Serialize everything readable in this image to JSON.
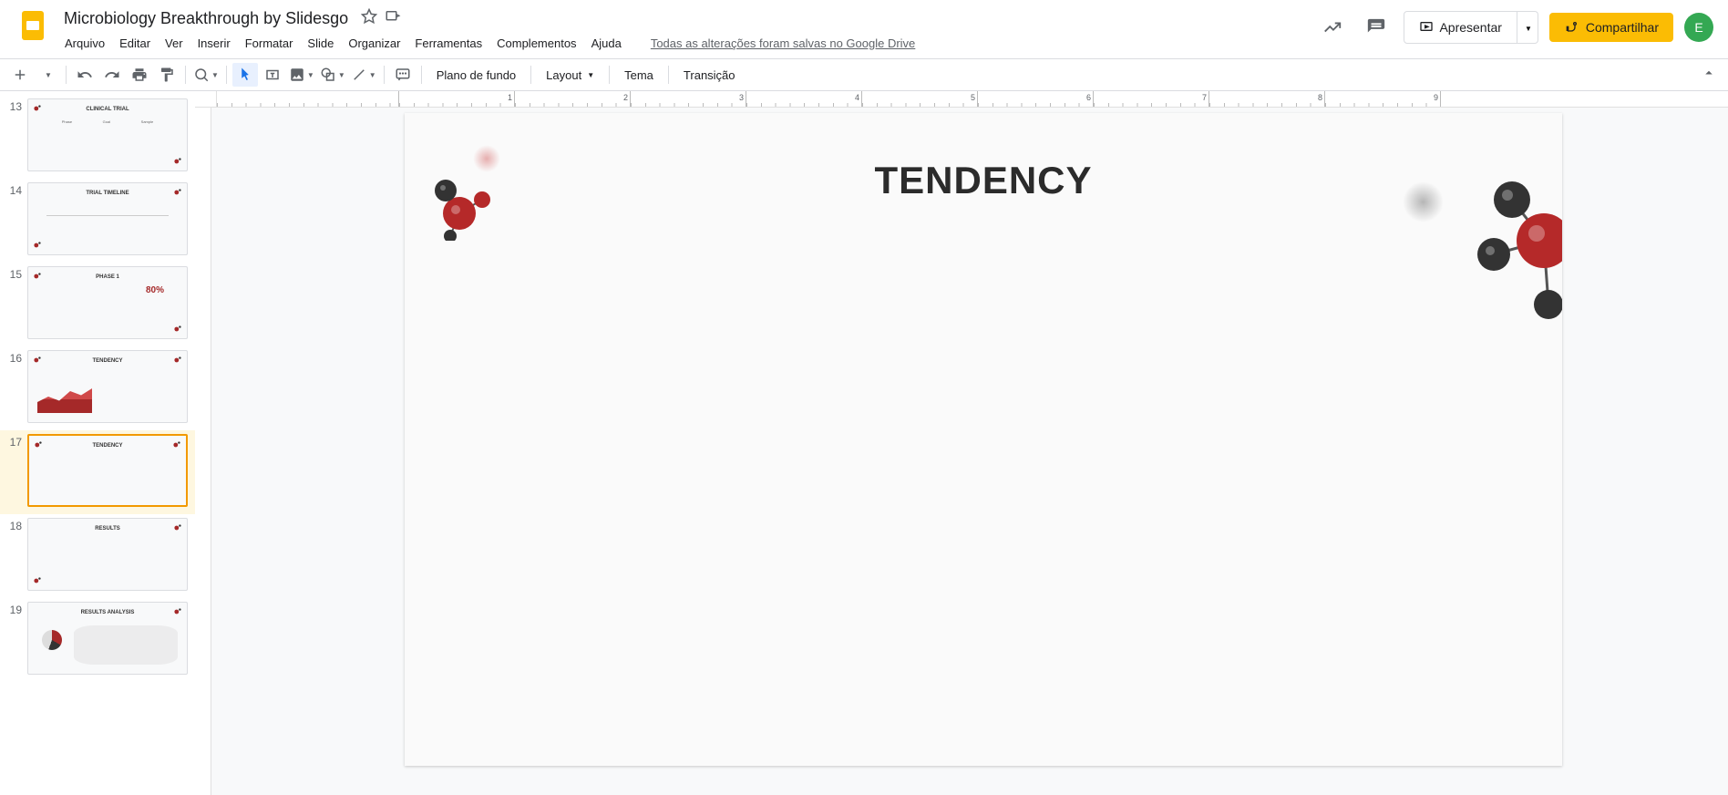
{
  "header": {
    "title": "Microbiology Breakthrough by Slidesgo",
    "save_status": "Todas as alterações foram salvas no Google Drive",
    "present_label": "Apresentar",
    "share_label": "Compartilhar",
    "avatar_letter": "E"
  },
  "menu": {
    "file": "Arquivo",
    "edit": "Editar",
    "view": "Ver",
    "insert": "Inserir",
    "format": "Formatar",
    "slide": "Slide",
    "arrange": "Organizar",
    "tools": "Ferramentas",
    "addons": "Complementos",
    "help": "Ajuda"
  },
  "toolbar": {
    "background": "Plano de fundo",
    "layout": "Layout",
    "theme": "Tema",
    "transition": "Transição"
  },
  "filmstrip": [
    {
      "num": "13",
      "title": "CLINICAL TRIAL",
      "type": "clinical"
    },
    {
      "num": "14",
      "title": "TRIAL TIMELINE",
      "type": "timeline"
    },
    {
      "num": "15",
      "title": "PHASE 1",
      "type": "phase",
      "percent": "80%"
    },
    {
      "num": "16",
      "title": "TENDENCY",
      "type": "chart"
    },
    {
      "num": "17",
      "title": "TENDENCY",
      "type": "blank",
      "selected": true
    },
    {
      "num": "18",
      "title": "RESULTS",
      "type": "table"
    },
    {
      "num": "19",
      "title": "RESULTS ANALYSIS",
      "type": "map"
    }
  ],
  "ruler": [
    "1",
    "2",
    "3",
    "4",
    "5",
    "6",
    "7",
    "8",
    "9"
  ],
  "slide": {
    "title": "TENDENCY"
  }
}
